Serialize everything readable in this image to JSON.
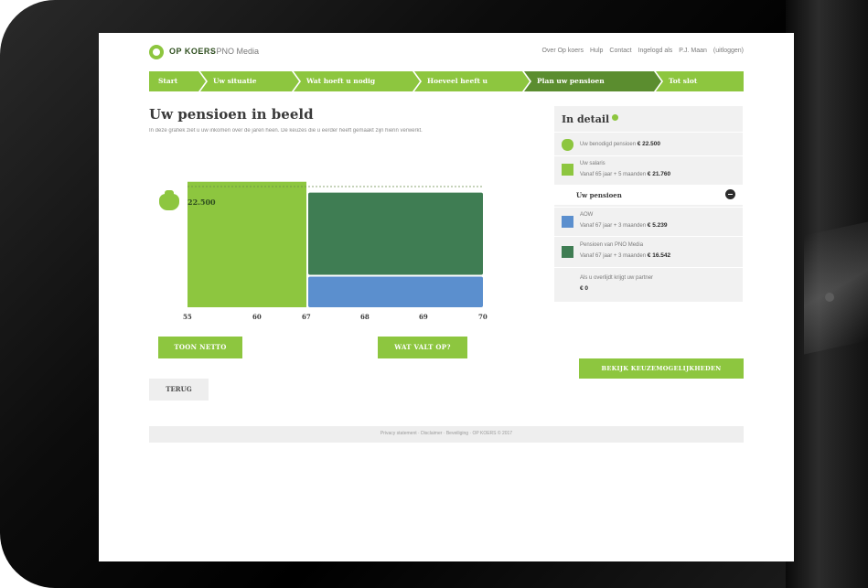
{
  "header": {
    "logo_text": "OP KOERS",
    "logo_separator": "-",
    "logo_subtitle": "PNO Media",
    "links": [
      "Over Op koers",
      "Hulp",
      "Contact",
      "Ingelogd als",
      "P.J. Maan",
      "(uitloggen)"
    ]
  },
  "steps": [
    {
      "label": "Start",
      "active": false
    },
    {
      "label": "Uw situatie",
      "active": false
    },
    {
      "label": "Wat hoeft u nodig",
      "active": false
    },
    {
      "label": "Hoeveel heeft u",
      "active": false
    },
    {
      "label": "Plan uw pensioen",
      "active": true
    },
    {
      "label": "Tot slot",
      "active": false
    }
  ],
  "main": {
    "title": "Uw pensioen in beeld",
    "intro": "In deze grafiek ziet u uw inkomen over de jaren heen. De keuzes die u eerder heeft gemaakt zijn hierin verwerkt."
  },
  "chart_data": {
    "type": "bar",
    "x_ticks": [
      "55",
      "60",
      "67",
      "68",
      "69",
      "70"
    ],
    "reference_label": "22.500",
    "reference_value": 22500,
    "segments": [
      {
        "name": "Uw salaris",
        "x_start": 55,
        "x_end": 65.4,
        "value": 21760,
        "color": "#8dc63f"
      },
      {
        "name": "AOW",
        "x_start": 65.4,
        "x_end": 70,
        "value": 5239,
        "color": "#5b8fce"
      },
      {
        "name": "Pensioen van PNO Media",
        "x_start": 65.4,
        "x_end": 70,
        "value": 16542,
        "color": "#3f7d53"
      }
    ]
  },
  "buttons": {
    "bruto_netto": "TOON NETTO",
    "wat_valt_op": "WAT VALT OP?",
    "back": "TERUG",
    "next": "BEKIJK KEUZEMOGELIJKHEDEN"
  },
  "detail": {
    "title": "In detail",
    "rows": [
      {
        "swatch": "#8dc63f",
        "label": "Uw benodigd pensioen",
        "value": "€ 22.500"
      },
      {
        "swatch": "#8dc63f",
        "label": "Uw salaris",
        "sub": "Vanaf 65 jaar + 5 maanden",
        "value": "€ 21.760"
      }
    ],
    "pension_header": "Uw pensioen",
    "pension_rows": [
      {
        "swatch": "#5b8fce",
        "label": "AOW",
        "sub": "Vanaf 67 jaar + 3 maanden",
        "value": "€ 5.239"
      },
      {
        "swatch": "#3f7d53",
        "label": "Pensioen van PNO Media",
        "sub": "Vanaf 67 jaar + 3 maanden",
        "value": "€ 16.542"
      },
      {
        "swatch": "",
        "label": "Als u overlijdt krijgt uw partner",
        "sub": "",
        "value": "€ 0"
      }
    ]
  },
  "footer": {
    "links": "Privacy statement · Disclaimer · Beveiliging · OP KOERS © 2017"
  },
  "colors": {
    "accent": "#8dc63f",
    "accent_dark": "#5b8d2f",
    "aow": "#5b8fce",
    "pension": "#3f7d53"
  }
}
